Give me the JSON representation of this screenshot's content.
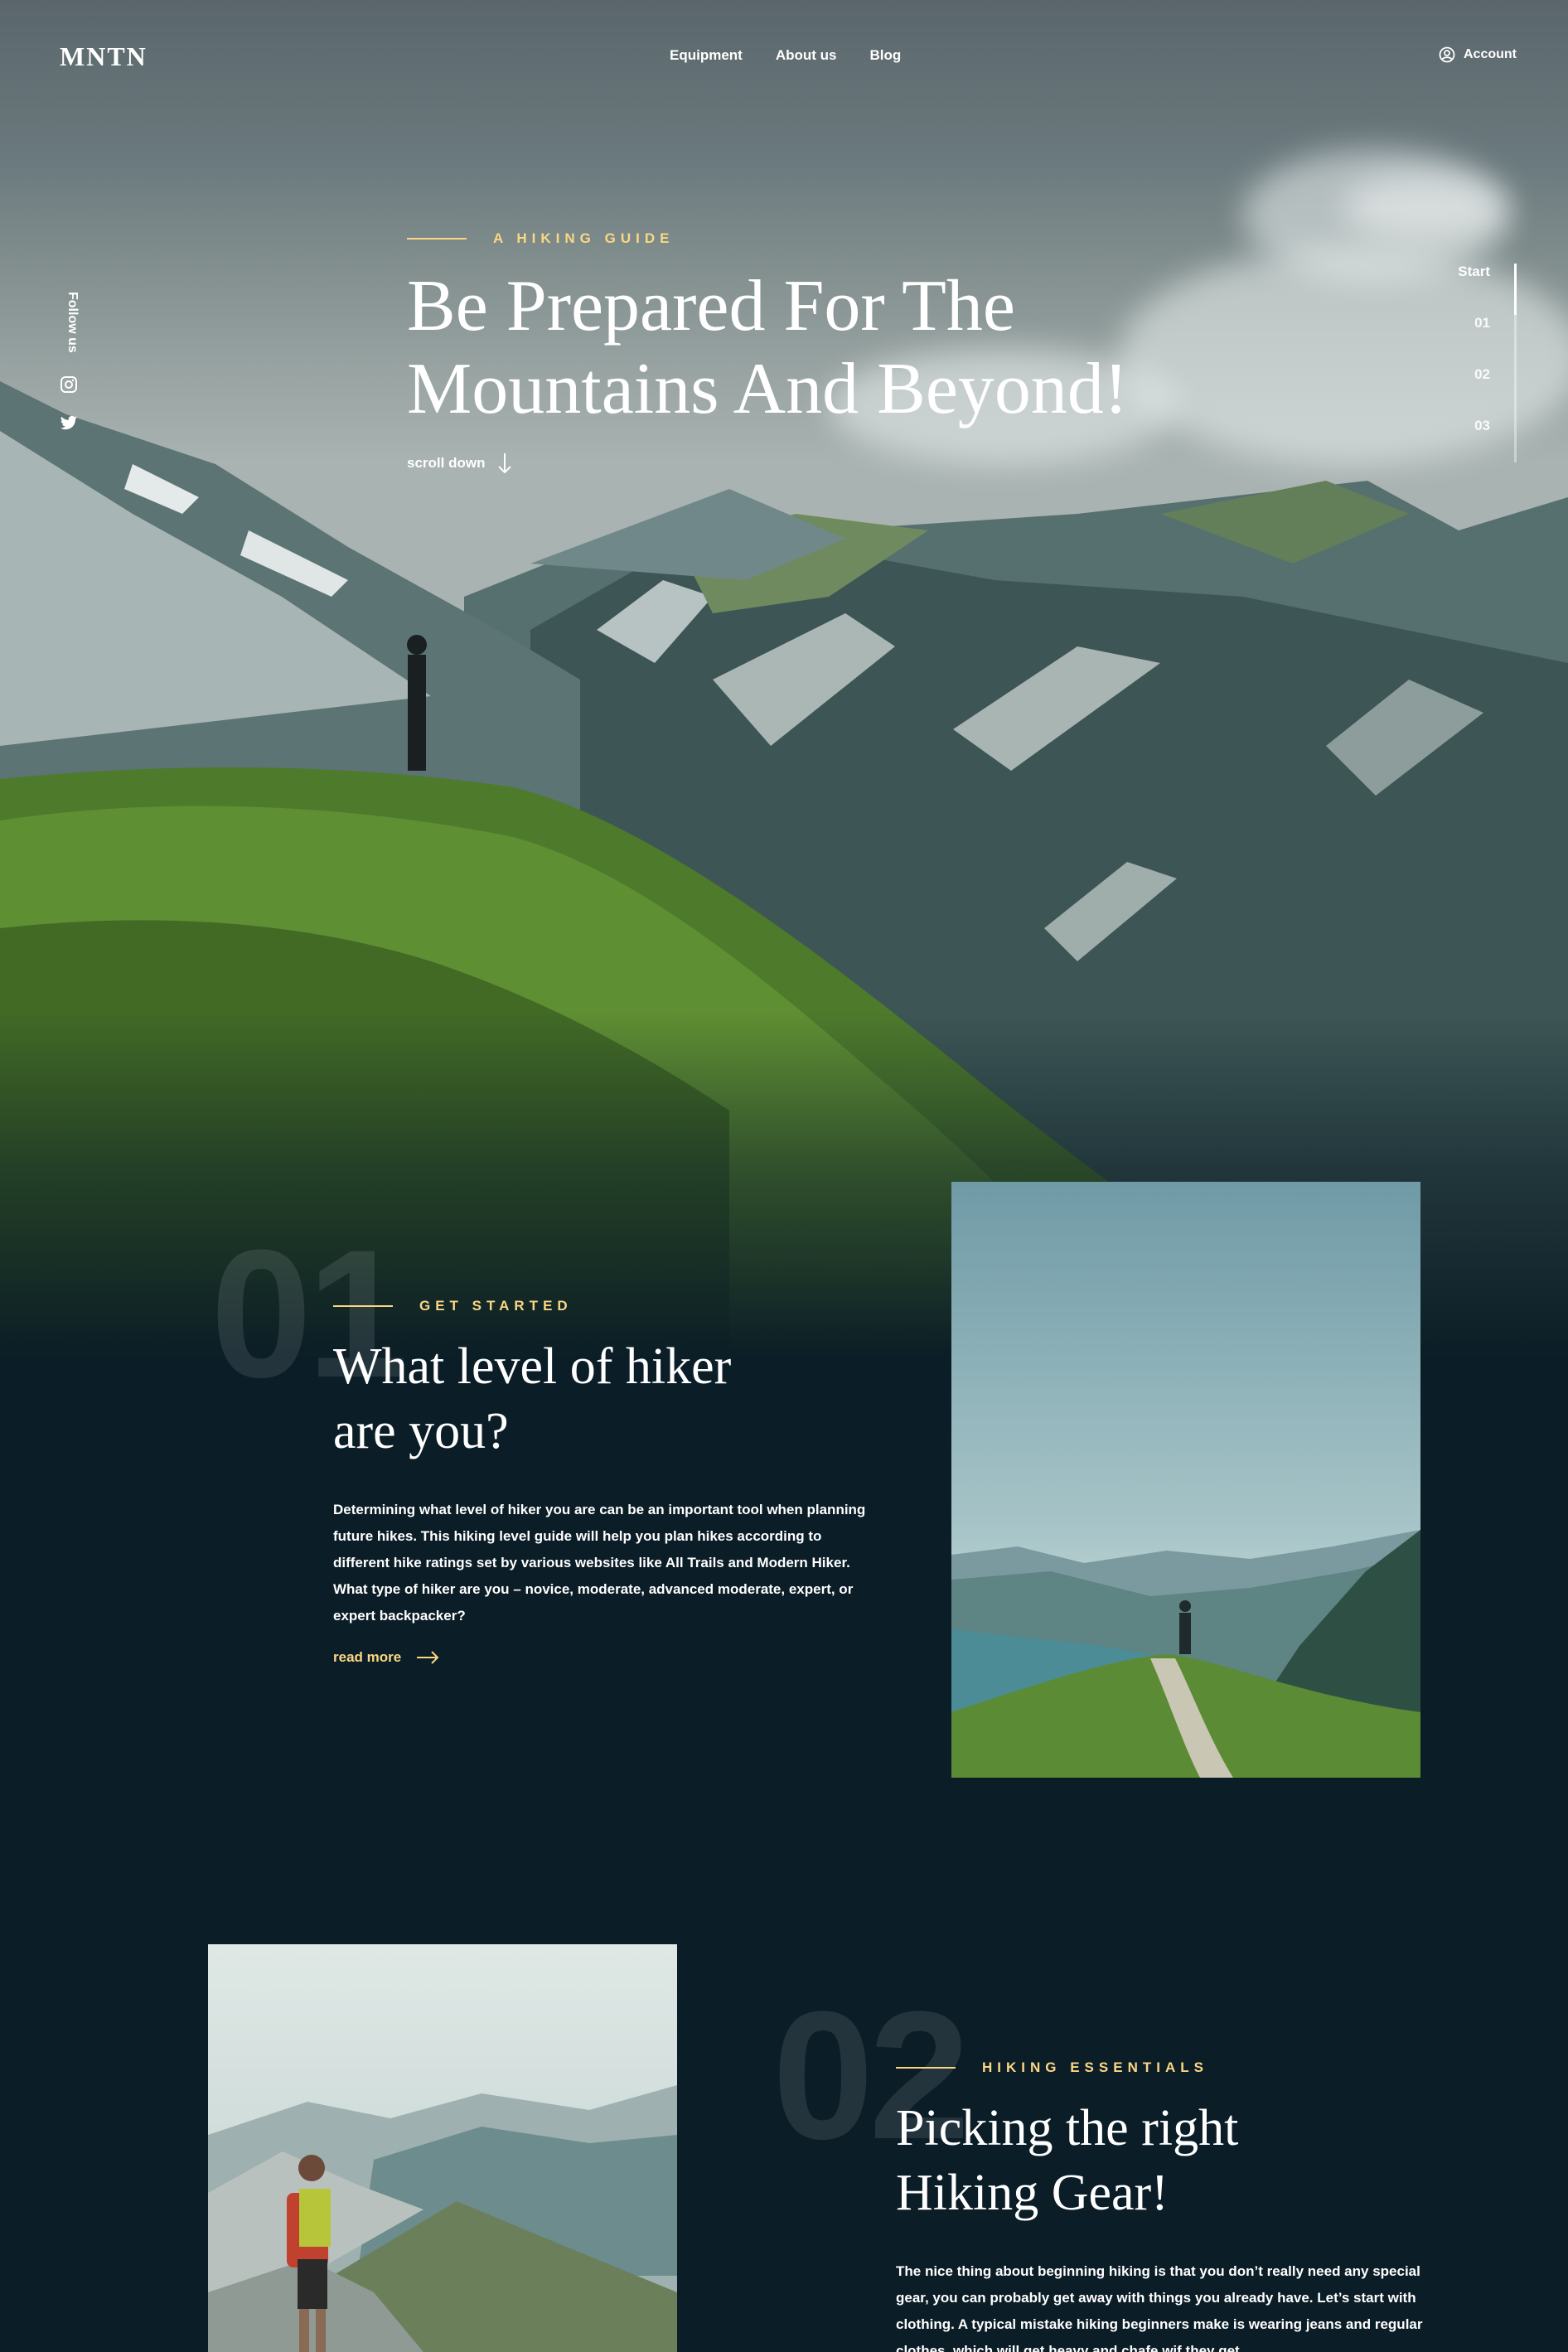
{
  "header": {
    "logo": "MNTN",
    "nav": [
      "Equipment",
      "About us",
      "Blog"
    ],
    "account_label": "Account"
  },
  "social": {
    "follow_label": "Follow us",
    "icons": [
      "instagram-icon",
      "twitter-icon"
    ]
  },
  "slider": {
    "items": [
      "Start",
      "01",
      "02",
      "03"
    ],
    "active_index": 0
  },
  "hero": {
    "eyebrow": "A HIKING GUIDE",
    "title_line1": "Be Prepared For The",
    "title_line2": "Mountains And Beyond!",
    "scroll_label": "scroll down"
  },
  "sections": [
    {
      "number": "01",
      "eyebrow": "GET STARTED",
      "title_line1": "What level of  hiker",
      "title_line2": "are you?",
      "body": "Determining what level of hiker you are can be an important tool when planning future hikes. This hiking level guide will help you plan hikes according to different hike ratings set by various websites like All Trails and Modern Hiker. What type of hiker are you – novice, moderate, advanced moderate, expert, or expert backpacker?",
      "read_more": "read more"
    },
    {
      "number": "02",
      "eyebrow": "HIKING ESSENTIALS",
      "title_line1": "Picking the right",
      "title_line2": "Hiking Gear!",
      "body": "The nice thing about beginning hiking is that you don’t really need any special gear, you can probably get away with things you already have. Let’s start with clothing. A typical mistake hiking beginners make is wearing jeans and regular clothes, which will get heavy and chafe wif they get"
    }
  ],
  "colors": {
    "accent": "#fbd784",
    "background": "#0b1d26",
    "text": "#ffffff"
  }
}
